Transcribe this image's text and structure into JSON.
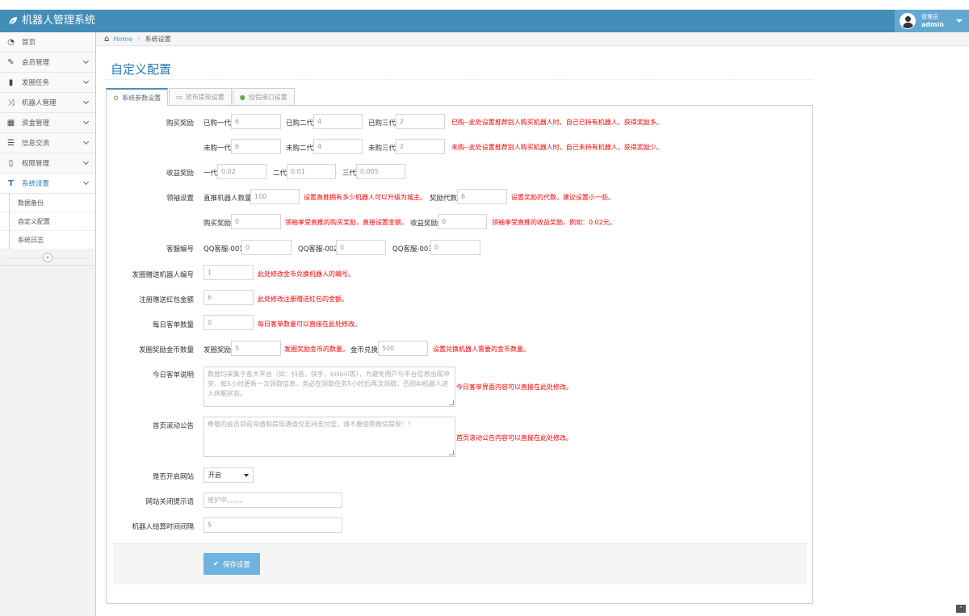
{
  "app": {
    "title": "机器人管理系统",
    "icon": "leaf-icon"
  },
  "user": {
    "role": "管理员",
    "name": "admin"
  },
  "sidebar": {
    "items": [
      {
        "label": "首页",
        "icon": "dashboard-icon"
      },
      {
        "label": "会员管理",
        "icon": "edit-icon"
      },
      {
        "label": "发圈任务",
        "icon": "book-icon"
      },
      {
        "label": "机器人管理",
        "icon": "shuffle-icon"
      },
      {
        "label": "资金管理",
        "icon": "calendar-icon"
      },
      {
        "label": "信息交流",
        "icon": "list-icon"
      },
      {
        "label": "权限管理",
        "icon": "file-icon"
      },
      {
        "label": "系统设置",
        "icon": "text-icon"
      }
    ],
    "sub_items": [
      "数据备份",
      "自定义配置",
      "系统日志"
    ]
  },
  "breadcrumb": {
    "home": "Home",
    "current": "系统设置"
  },
  "page_title": "自定义配置",
  "tabs": [
    "系统参数设置",
    "货币提现设置",
    "短信接口设置"
  ],
  "form": {
    "buy_reward": {
      "label": "购买奖励",
      "bought": {
        "l1": "已购一代",
        "v1": "6",
        "l2": "已购二代",
        "v2": "4",
        "l3": "已购三代",
        "v3": "2",
        "hint": "已购--此处设置推荐别人购买机器人时，自己已持有机器人，获得奖励多。"
      },
      "unbought": {
        "l1": "未购一代",
        "v1": "6",
        "l2": "未购二代",
        "v2": "4",
        "l3": "未购三代",
        "v3": "2",
        "hint": "未购--此处设置推荐别人购买机器人时，自己未持有机器人，获得奖励少。"
      }
    },
    "income_reward": {
      "label": "收益奖励",
      "l1": "一代",
      "v1": "0.02",
      "l2": "二代",
      "v2": "0.01",
      "l3": "三代",
      "v3": "0.005"
    },
    "leader": {
      "label": "领袖设置",
      "direct_label": "直推机器人数量",
      "direct_value": "100",
      "direct_hint": "设置直推拥有多少机器人可以升级为城主。",
      "gen_label": "奖励代数",
      "gen_value": "6",
      "gen_hint": "设置奖励的代数，建议设置小一些。",
      "buy_label": "购买奖励",
      "buy_value": "0",
      "buy_hint": "领袖享受直推的购买奖励，直接设置金额。",
      "income_label": "收益奖励",
      "income_value": "0",
      "income_hint": "领袖享受直推的收益奖励，例如：0.02元。"
    },
    "service": {
      "label": "客服编号",
      "l1": "QQ客服-001",
      "v1": "0",
      "l2": "QQ客服-002",
      "v2": "0",
      "l3": "QQ客服-003",
      "v3": "0"
    },
    "gift_robot": {
      "label": "发圈赠送机器人编号",
      "value": "1",
      "hint": "此处修改金币兑换机器人的编号。"
    },
    "register_gift": {
      "label": "注册赠送红包金额",
      "value": "6",
      "hint": "此处修改注册赠送红包的金额。"
    },
    "daily_orders": {
      "label": "每日客单数量",
      "value": "0",
      "hint": "每日客单数量可以直接在此处修改。"
    },
    "coin_reward": {
      "label": "发圈奖励金币数量",
      "reward_label": "发圈奖励",
      "reward_value": "5",
      "reward_hint": "发圈奖励金币的数量。",
      "exchange_label": "金币兑换",
      "exchange_value": "500",
      "exchange_hint": "设置兑换机器人需要的金币数量。"
    },
    "today_desc": {
      "label": "今日客单说明",
      "value": "数据均采集于各大平台（如：抖音，快手，bilibili等），为避免用户与平台信息出现冲突，每5小时更新一次领取信息，务必在领取任务5小时后再次领取，否则AI机器人进入休眠状态。",
      "hint": "今日客单界面内容可以直接在此处修改。"
    },
    "scroll_notice": {
      "label": "首页滚动公告",
      "value": "尊敬的会员目前充值和提现通道仅支持支付宝，请不要使用微信提现！！",
      "hint": "首页滚动公告内容可以直接在此处修改。"
    },
    "site_open": {
      "label": "是否开启网站",
      "value": "开启"
    },
    "close_msg": {
      "label": "网站关闭提示语",
      "placeholder": "维护中。。。。。"
    },
    "settle_interval": {
      "label": "机器人结算时间间隔",
      "value": "5"
    }
  },
  "save_button": "保存设置"
}
